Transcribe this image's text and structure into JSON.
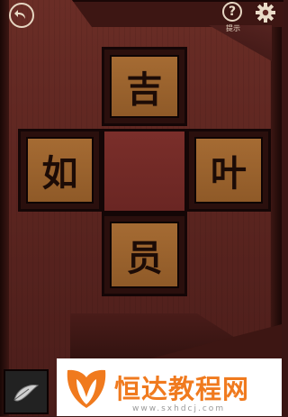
{
  "hud": {
    "back_icon": "back-arrow-icon",
    "hint_symbol": "?",
    "hint_label": "提示",
    "settings_icon": "gear-icon"
  },
  "puzzle": {
    "tiles": {
      "top": "吉",
      "left": "如",
      "right": "叶",
      "bottom": "员"
    },
    "center": ""
  },
  "inventory": {
    "item_icon": "feather-icon"
  },
  "watermark": {
    "title": "恒达教程网",
    "url": "www.sxhdcj.com"
  },
  "colors": {
    "wall": "#5c2520",
    "tile": "#9b632e",
    "center_slot": "#722a26",
    "watermark_orange": "#f07a1e"
  }
}
